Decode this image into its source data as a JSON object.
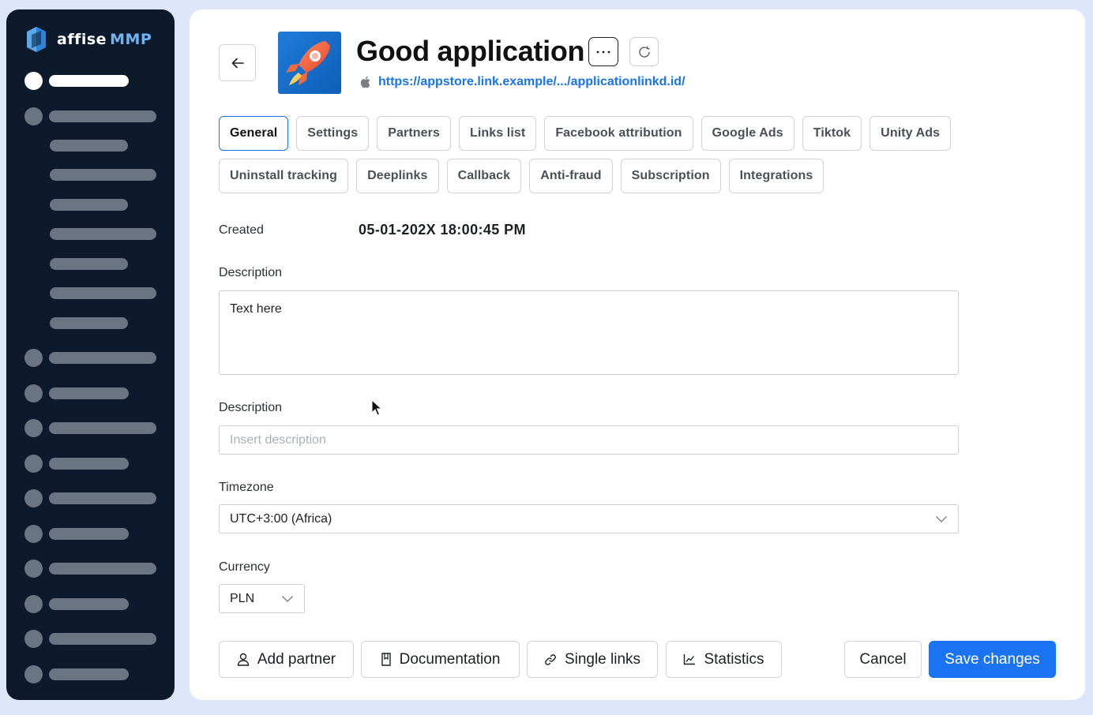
{
  "brand": {
    "name": "affise",
    "product": "MMP"
  },
  "header": {
    "title": "Good application",
    "link": "https://appstore.link.example/.../applicationlinkd.id/",
    "more_label": "···"
  },
  "tabs": {
    "row1": [
      "General",
      "Settings",
      "Partners",
      "Links list",
      "Facebook attribution",
      "Google Ads",
      "Tiktok",
      "Unity Ads"
    ],
    "row2": [
      "Uninstall tracking",
      "Deeplinks",
      "Callback",
      "Anti-fraud",
      "Subscription",
      "Integrations"
    ],
    "active": "General"
  },
  "form": {
    "created_label": "Created",
    "created_value": "05-01-202X 18:00:45 PM",
    "description1_label": "Description",
    "description1_value": "Text here",
    "description2_label": "Description",
    "description2_placeholder": "Insert description",
    "timezone_label": "Timezone",
    "timezone_value": "UTC+3:00 (Africa)",
    "currency_label": "Currency",
    "currency_value": "PLN"
  },
  "footer": {
    "add_partner": "Add partner",
    "documentation": "Documentation",
    "single_links": "Single links",
    "statistics": "Statistics",
    "cancel": "Cancel",
    "save": "Save changes"
  },
  "colors": {
    "sidebar_bg": "#0c1a2c",
    "accent": "#1a73f0",
    "page_bg": "#dde6fb"
  }
}
